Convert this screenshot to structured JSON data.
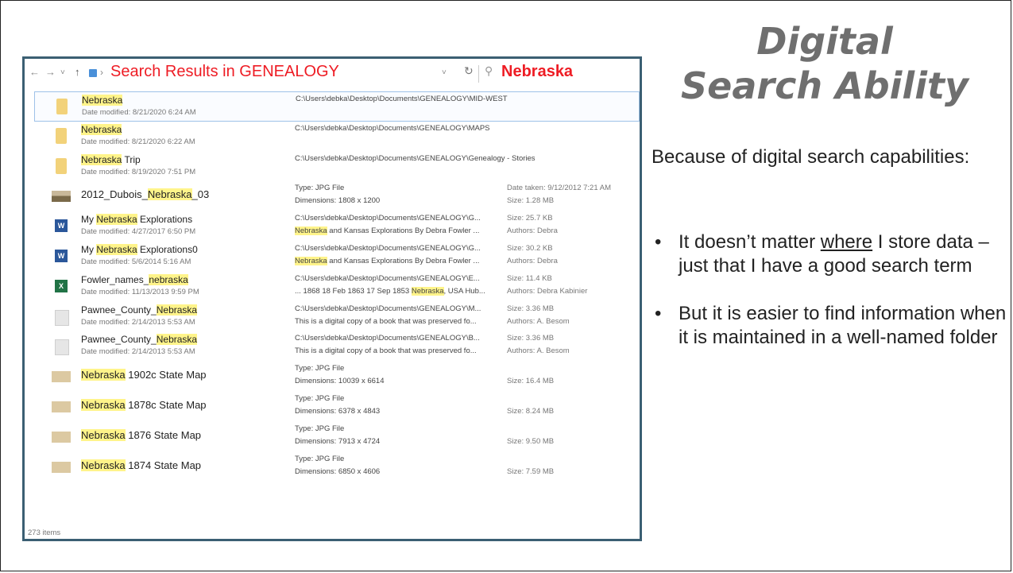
{
  "slide": {
    "title_line1": "Digital",
    "title_line2": "Search Ability",
    "intro": "Because of digital search capabilities:",
    "bullet1_before": "It doesn’t matter ",
    "bullet1_underlined": "where",
    "bullet1_after": " I store data – just that I have a good search term",
    "bullet2": "But it is easier to find information when it is maintained in a well-named folder"
  },
  "explorer": {
    "address_title": "Search Results in GENEALOGY",
    "search_query": "Nebraska",
    "status": "273 items",
    "rows": [
      {
        "name_hl": "Nebraska",
        "name_rest": "",
        "date": "Date modified: 8/21/2020 6:24 AM",
        "loc1": "C:\\Users\\debka\\Desktop\\Documents\\GENEALOGY\\MID-WEST",
        "loc2": "",
        "col3a": "",
        "col3b": "",
        "icon": "folder-icon"
      },
      {
        "name_hl": "Nebraska",
        "name_rest": "",
        "date": "Date modified: 8/21/2020 6:22 AM",
        "loc1": "C:\\Users\\debka\\Desktop\\Documents\\GENEALOGY\\MAPS",
        "loc2": "",
        "col3a": "",
        "col3b": "",
        "icon": "folder-icon"
      },
      {
        "name_hl": "Nebraska",
        "name_rest": " Trip",
        "date": "Date modified: 8/19/2020 7:51 PM",
        "loc1": "C:\\Users\\debka\\Desktop\\Documents\\GENEALOGY\\Genealogy - Stories",
        "loc2": "",
        "col3a": "",
        "col3b": "",
        "icon": "folder-icon"
      },
      {
        "name_pre": "2012_Dubois_",
        "name_hl": "Nebraska",
        "name_rest": "_03",
        "date": "",
        "loc1": "Type: JPG File",
        "loc2": "Dimensions: 1808 x 1200",
        "col3a": "Date taken: 9/12/2012 7:21 AM",
        "col3b": "Size: 1.28 MB",
        "icon": "photo-icon"
      },
      {
        "name_pre": "My ",
        "name_hl": "Nebraska",
        "name_rest": " Explorations",
        "date": "Date modified: 4/27/2017 6:50 PM",
        "loc1": "C:\\Users\\debka\\Desktop\\Documents\\GENEALOGY\\G...",
        "loc2_hl": "Nebraska",
        "loc2": " and Kansas Explorations By Debra Fowler ...",
        "col3a": "Size: 25.7 KB",
        "col3b": "Authors: Debra",
        "icon": "word-icon"
      },
      {
        "name_pre": "My ",
        "name_hl": "Nebraska",
        "name_rest": " Explorations0",
        "date": "Date modified: 5/6/2014 5:16 AM",
        "loc1": "C:\\Users\\debka\\Desktop\\Documents\\GENEALOGY\\G...",
        "loc2_hl": "Nebraska",
        "loc2": " and Kansas Explorations By Debra Fowler ...",
        "col3a": "Size: 30.2 KB",
        "col3b": "Authors: Debra",
        "icon": "word-icon"
      },
      {
        "name_pre": "Fowler_names_",
        "name_hl": "nebraska",
        "name_rest": "",
        "date": "Date modified: 11/13/2013 9:59 PM",
        "loc1": "C:\\Users\\debka\\Desktop\\Documents\\GENEALOGY\\E...",
        "loc2_pre": "... 1868 18 Feb 1863 17 Sep 1853 ",
        "loc2_hl": "Nebraska",
        "loc2": ", USA Hub...",
        "col3a": "Size: 11.4 KB",
        "col3b": "Authors: Debra Kabinier",
        "icon": "excel-icon"
      },
      {
        "name_pre": "Pawnee_County_",
        "name_hl": "Nebraska",
        "name_rest": "",
        "date": "Date modified: 2/14/2013 5:53 AM",
        "loc1": "C:\\Users\\debka\\Desktop\\Documents\\GENEALOGY\\M...",
        "loc2": "This is a digital copy of a book that was preserved fo...",
        "col3a": "Size: 3.36 MB",
        "col3b": "Authors: A. Besom",
        "icon": "document-icon"
      },
      {
        "name_pre": "Pawnee_County_",
        "name_hl": "Nebraska",
        "name_rest": "",
        "date": "Date modified: 2/14/2013 5:53 AM",
        "loc1": "C:\\Users\\debka\\Desktop\\Documents\\GENEALOGY\\B...",
        "loc2": "This is a digital copy of a book that was preserved fo...",
        "col3a": "Size: 3.36 MB",
        "col3b": "Authors: A. Besom",
        "icon": "document-icon"
      },
      {
        "name_hl": "Nebraska",
        "name_rest": " 1902c State Map",
        "date": "",
        "loc1": "Type: JPG File",
        "loc2": "Dimensions: 10039 x 6614",
        "col3a": "",
        "col3b": "Size: 16.4 MB",
        "icon": "map-icon"
      },
      {
        "name_hl": "Nebraska",
        "name_rest": " 1878c State Map",
        "date": "",
        "loc1": "Type: JPG File",
        "loc2": "Dimensions: 6378 x 4843",
        "col3a": "",
        "col3b": "Size: 8.24 MB",
        "icon": "map-icon"
      },
      {
        "name_hl": "Nebraska",
        "name_rest": " 1876 State Map",
        "date": "",
        "loc1": "Type: JPG File",
        "loc2": "Dimensions: 7913 x 4724",
        "col3a": "",
        "col3b": "Size: 9.50 MB",
        "icon": "map-icon"
      },
      {
        "name_hl": "Nebraska",
        "name_rest": " 1874 State Map",
        "date": "",
        "loc1": "Type: JPG File",
        "loc2": "Dimensions: 6850 x 4606",
        "col3a": "",
        "col3b": "Size: 7.59 MB",
        "icon": "map-icon"
      }
    ]
  }
}
